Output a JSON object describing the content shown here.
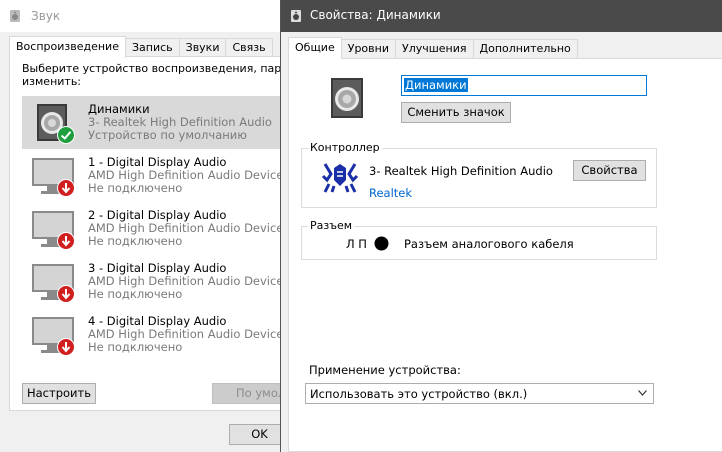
{
  "sound_window": {
    "title": "Звук",
    "tabs": [
      {
        "label": "Воспроизведение",
        "active": true
      },
      {
        "label": "Запись",
        "active": false
      },
      {
        "label": "Звуки",
        "active": false
      },
      {
        "label": "Связь",
        "active": false
      }
    ],
    "instruction_line1": "Выберите устройство воспроизведения, параме",
    "instruction_line2": "изменить:",
    "devices": [
      {
        "name": "Динамики",
        "driver": "3- Realtek High Definition Audio",
        "status": "Устройство по умолчанию",
        "selected": true,
        "badge": "default-check"
      },
      {
        "name": "1 - Digital Display Audio",
        "driver": "AMD High Definition Audio Device",
        "status": "Не подключено",
        "selected": false,
        "badge": "disconnected-arrow"
      },
      {
        "name": "2 - Digital Display Audio",
        "driver": "AMD High Definition Audio Device",
        "status": "Не подключено",
        "selected": false,
        "badge": "disconnected-arrow"
      },
      {
        "name": "3 - Digital Display Audio",
        "driver": "AMD High Definition Audio Device",
        "status": "Не подключено",
        "selected": false,
        "badge": "disconnected-arrow"
      },
      {
        "name": "4 - Digital Display Audio",
        "driver": "AMD High Definition Audio Device",
        "status": "Не подключено",
        "selected": false,
        "badge": "disconnected-arrow"
      }
    ],
    "configure_button": "Настроить",
    "default_button": "По умол",
    "ok_button": "OK"
  },
  "properties_window": {
    "title": "Свойства: Динамики",
    "tabs": [
      {
        "label": "Общие",
        "active": true
      },
      {
        "label": "Уровни",
        "active": false
      },
      {
        "label": "Улучшения",
        "active": false
      },
      {
        "label": "Дополнительно",
        "active": false
      }
    ],
    "device_name": "Динамики",
    "change_icon_button": "Сменить значок",
    "controller": {
      "label": "Контроллер",
      "name": "3- Realtek High Definition Audio",
      "vendor_link": "Realtek",
      "properties_button": "Свойства"
    },
    "jack": {
      "label": "Разъем",
      "sides": "Л П",
      "jack_color": "#000000",
      "description": "Разъем аналогового кабеля"
    },
    "device_usage": {
      "label": "Применение устройства:",
      "selected": "Использовать это устройство (вкл.)"
    }
  },
  "colors": {
    "accent": "#0078d7",
    "selection_bg": "#d9d9d9",
    "front_titlebar": "#4a4a4a",
    "default_badge": "#1e9e3e",
    "disconnected_badge": "#d01f1f",
    "realtek_blue": "#1a2fa8"
  }
}
